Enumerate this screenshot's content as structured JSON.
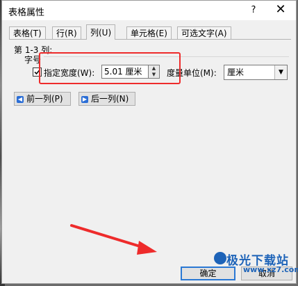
{
  "dialog": {
    "title": "表格属性"
  },
  "window_controls": {
    "help": "?",
    "close": "✕"
  },
  "tabs": [
    {
      "label": "表格(T)",
      "active": false
    },
    {
      "label": "行(R)",
      "active": false
    },
    {
      "label": "列(U)",
      "active": true
    },
    {
      "label": "单元格(E)",
      "active": false
    },
    {
      "label": "可选文字(A)",
      "active": false
    }
  ],
  "column_panel": {
    "section_label": "第 1-3 列:",
    "group_label": "字号",
    "checkbox_label": "指定宽度(W):",
    "checkbox_checked": true,
    "width_value": "5.01 厘米",
    "unit_label": "度量单位(M):",
    "unit_selected": "厘米"
  },
  "nav": {
    "prev_label": "前一列(P)",
    "next_label": "后一列(N)"
  },
  "footer": {
    "ok_label": "确定",
    "cancel_label": "取消"
  },
  "watermark": {
    "title": "极光下载站",
    "url": "www.xz7.com"
  },
  "colors": {
    "highlight": "#ee2b2b",
    "accent": "#2a78d4"
  }
}
